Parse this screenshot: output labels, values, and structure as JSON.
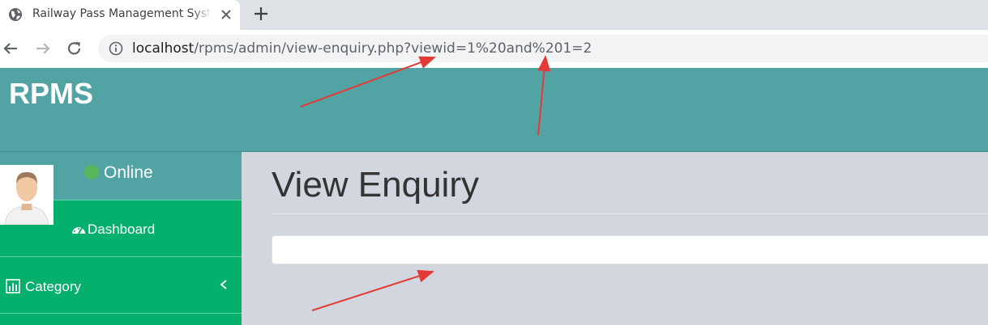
{
  "browser": {
    "tab_title": "Railway Pass Management System",
    "url_host": "localhost",
    "url_path": "/rpms/admin/view-enquiry.php?viewid=1%20and%201=2",
    "icons": [
      "globe-icon",
      "close-icon",
      "plus-icon",
      "back-arrow-icon",
      "forward-arrow-icon",
      "reload-icon",
      "info-icon"
    ]
  },
  "app": {
    "logo": "RPMS"
  },
  "sidebar": {
    "status": "Online",
    "items": [
      {
        "label": "Dashboard",
        "icon": "dashboard-icon"
      },
      {
        "label": "Category",
        "icon": "bar-chart-icon",
        "has_chevron": true
      }
    ]
  },
  "content": {
    "page_title": "View Enquiry"
  },
  "colors": {
    "header": "#52a3a3",
    "sidebar": "#05b06d",
    "content_bg": "#d2d6de",
    "annotation_arrow": "#e53935"
  }
}
